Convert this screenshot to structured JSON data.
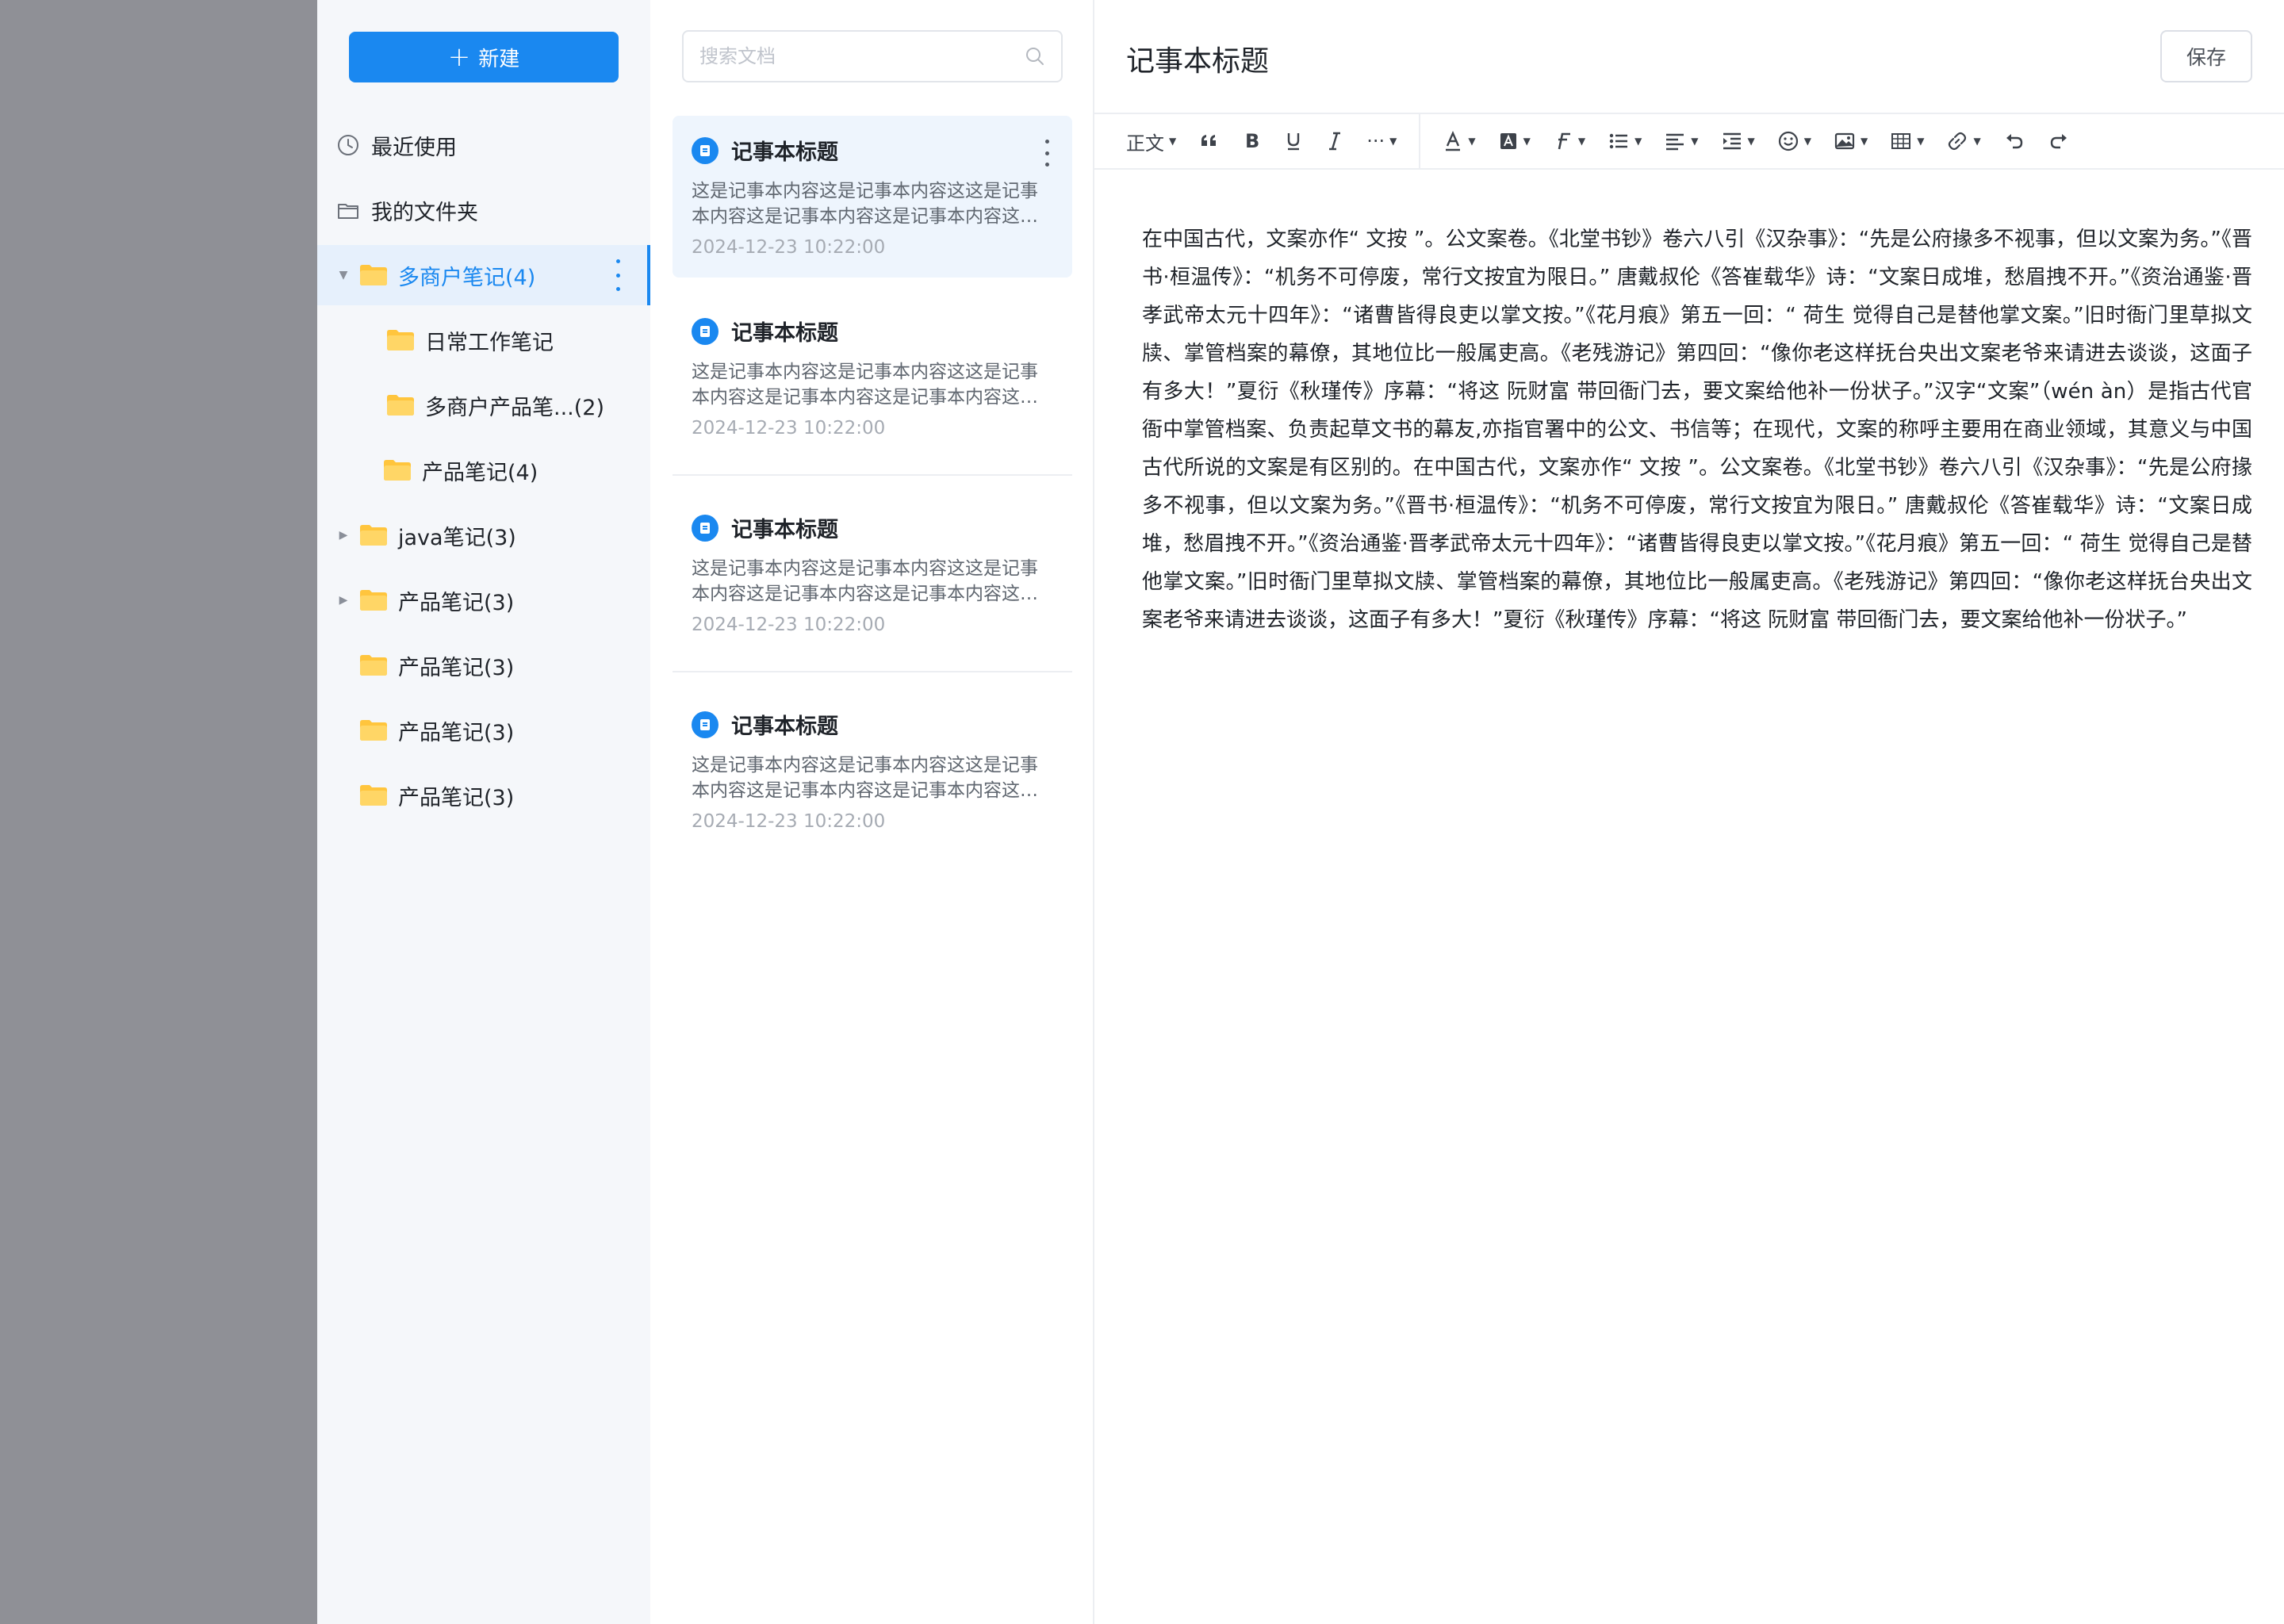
{
  "sidebar": {
    "new_button_label": "新建",
    "nav": [
      {
        "label": "最近使用",
        "icon": "clock-icon"
      },
      {
        "label": "我的文件夹",
        "icon": "folder-outline-icon"
      }
    ],
    "tree": [
      {
        "label": "多商户笔记(4)",
        "level": 0,
        "caret": "down",
        "active": true
      },
      {
        "label": "日常工作笔记",
        "level": 1
      },
      {
        "label": "多商户产品笔...(2)",
        "level": 1
      },
      {
        "label": "产品笔记(4)",
        "level": 1
      },
      {
        "label": "java笔记(3)",
        "level": 0,
        "caret": "right"
      },
      {
        "label": "产品笔记(3)",
        "level": 0,
        "caret": "right"
      },
      {
        "label": "产品笔记(3)",
        "level": 0
      },
      {
        "label": "产品笔记(3)",
        "level": 0
      },
      {
        "label": "产品笔记(3)",
        "level": 0
      }
    ]
  },
  "list": {
    "search_placeholder": "搜索文档",
    "notes": [
      {
        "title": "记事本标题",
        "snippet": "这是记事本内容这是记事本内容这这是记事本内容这是记事本内容这是记事本内容这是记事本内容",
        "time": "2024-12-23 10:22:00",
        "selected": true
      },
      {
        "title": "记事本标题",
        "snippet": "这是记事本内容这是记事本内容这这是记事本内容这是记事本内容这是记事本内容这是记事本内容",
        "time": "2024-12-23 10:22:00"
      },
      {
        "title": "记事本标题",
        "snippet": "这是记事本内容这是记事本内容这这是记事本内容这是记事本内容这是记事本内容这是记事本内容",
        "time": "2024-12-23 10:22:00"
      },
      {
        "title": "记事本标题",
        "snippet": "这是记事本内容这是记事本内容这这是记事本内容这是记事本内容这是记事本内容这是记事本内容",
        "time": "2024-12-23 10:22:00"
      }
    ]
  },
  "editor": {
    "title": "记事本标题",
    "save_label": "保存",
    "toolbar": {
      "paragraph_label": "正文",
      "more_label": "···"
    },
    "content": "在中国古代，文案亦作“ 文按 ”。公文案卷。《北堂书钞》卷六八引《汉杂事》：“先是公府掾多不视事，但以文案为务。”《晋书·桓温传》：“机务不可停废，常行文按宜为限日。” 唐戴叔伦《答崔载华》诗：“文案日成堆，愁眉拽不开。”《资治通鉴·晋孝武帝太元十四年》：“诸曹皆得良吏以掌文按。”《花月痕》第五一回：“ 荷生 觉得自己是替他掌文案。”旧时衙门里草拟文牍、掌管档案的幕僚，其地位比一般属吏高。《老残游记》第四回：“像你老这样抚台央出文案老爷来请进去谈谈，这面子有多大！”夏衍《秋瑾传》序幕：“将这 阮财富 带回衙门去，要文案给他补一份状子。”汉字“文案”（wén àn）是指古代官衙中掌管档案、负责起草文书的幕友,亦指官署中的公文、书信等；在现代，文案的称呼主要用在商业领域，其意义与中国古代所说的文案是有区别的。在中国古代，文案亦作“ 文按 ”。公文案卷。《北堂书钞》卷六八引《汉杂事》：“先是公府掾多不视事，但以文案为务。”《晋书·桓温传》：“机务不可停废，常行文按宜为限日。” 唐戴叔伦《答崔载华》诗：“文案日成堆，愁眉拽不开。”《资治通鉴·晋孝武帝太元十四年》：“诸曹皆得良吏以掌文按。”《花月痕》第五一回：“ 荷生 觉得自己是替他掌文案。”旧时衙门里草拟文牍、掌管档案的幕僚，其地位比一般属吏高。《老残游记》第四回：“像你老这样抚台央出文案老爷来请进去谈谈，这面子有多大！”夏衍《秋瑾传》序幕：“将这 阮财富 带回衙门去，要文案给他补一份状子。”"
  },
  "colors": {
    "accent": "#1a88f0",
    "folder": "#ffc53d",
    "sidebar_bg": "#f5f7fa",
    "overlay_gray": "#8f9096"
  }
}
